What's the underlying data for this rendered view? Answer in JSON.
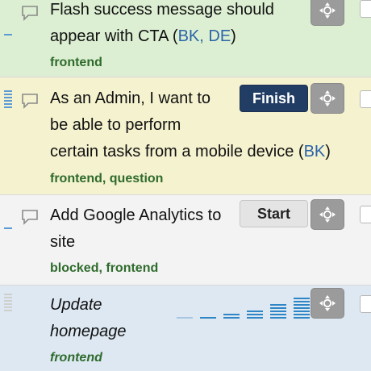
{
  "stories": [
    {
      "title": "Flash success message should",
      "title_line2": "appear with CTA (",
      "owners": "BK, DE",
      "title_close": ")",
      "labels": [
        "frontend"
      ],
      "action": null,
      "points": 1
    },
    {
      "title": "As an Admin, I want to",
      "title_line2": "be able to perform",
      "title_line3": "certain tasks from a mobile device (",
      "owners": "BK",
      "title_close": ")",
      "labels": [
        "frontend",
        "question"
      ],
      "action": "Finish",
      "points": 8
    },
    {
      "title": "Add Google Analytics to",
      "title_line2": "site",
      "labels": [
        "blocked",
        "frontend"
      ],
      "action": "Start",
      "points": 1
    },
    {
      "title": "Update",
      "title_line2": "homepage",
      "labels": [
        "frontend"
      ],
      "action": null,
      "points": 0,
      "estimate_options": [
        0,
        1,
        2,
        3,
        5,
        8
      ]
    }
  ],
  "label_separator": ",",
  "colors": {
    "accepted_bg": "#dcefd2",
    "started_bg": "#f5f2cf",
    "unstarted_bg": "#f3f3f3",
    "unscheduled_bg": "#dde8f2",
    "finish_button": "#223d64",
    "label_green": "#2e6b2c",
    "owner_blue": "#2b64a8"
  },
  "icons": [
    "comment-icon",
    "move-icon",
    "checkbox"
  ]
}
